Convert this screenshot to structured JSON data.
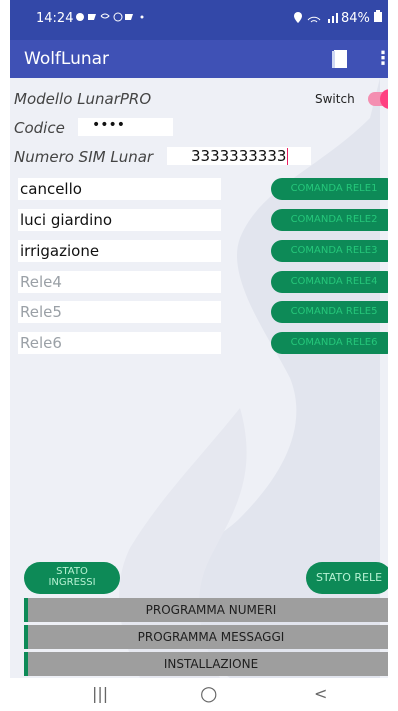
{
  "status_bar": {
    "time": "14:24",
    "battery": "84%"
  },
  "app_bar": {
    "title": "WolfLunar"
  },
  "form": {
    "model_label": "Modello LunarPRO",
    "switch_label": "Switch",
    "code_label": "Codice",
    "code_value": "••••",
    "sim_label": "Numero SIM Lunar",
    "sim_value": "3333333333"
  },
  "relays": [
    {
      "name": "cancello",
      "button": "COMANDA RELE1",
      "is_hint": false
    },
    {
      "name": "luci giardino",
      "button": "COMANDA RELE2",
      "is_hint": false
    },
    {
      "name": "irrigazione",
      "button": "COMANDA RELE3",
      "is_hint": false
    },
    {
      "name": "Rele4",
      "button": "COMANDA RELE4",
      "is_hint": true
    },
    {
      "name": "Rele5",
      "button": "COMANDA RELE5",
      "is_hint": true
    },
    {
      "name": "Rele6",
      "button": "COMANDA RELE6",
      "is_hint": true
    }
  ],
  "bottom": {
    "stato_ingressi_line1": "STATO",
    "stato_ingressi_line2": "INGRESSI",
    "stato_rele": "STATO RELE",
    "programma_numeri": "PROGRAMMA NUMERI",
    "programma_messaggi": "PROGRAMMA MESSAGGI",
    "installazione": "INSTALLAZIONE"
  },
  "nav": {
    "recents": "|||",
    "home": "○",
    "back": "<"
  },
  "colors": {
    "status_bar": "#3348a8",
    "app_bar": "#3f51b5",
    "accent_green": "#0d8a57",
    "switch_on": "#ff4081"
  }
}
